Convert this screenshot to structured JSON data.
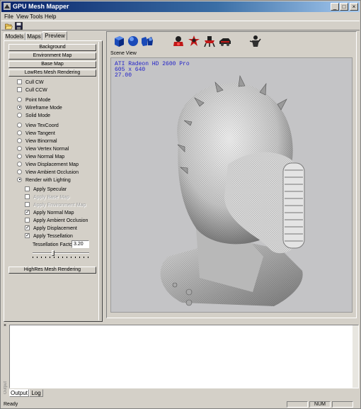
{
  "window": {
    "title": "GPU Mesh Mapper",
    "min": "_",
    "max": "□",
    "close": "×"
  },
  "menu": [
    "File",
    "View",
    "Tools",
    "Help"
  ],
  "left": {
    "tabs": [
      "Models",
      "Maps",
      "Preview"
    ],
    "active_tab": "Preview",
    "buttons": [
      "Background",
      "Environment Map",
      "Base Map",
      "LowRes Mesh Rendering"
    ],
    "cull": [
      {
        "label": "Cull CW",
        "checked": false
      },
      {
        "label": "Cull CCW",
        "checked": false
      }
    ],
    "modes": [
      {
        "label": "Point Mode",
        "selected": false
      },
      {
        "label": "Wireframe Mode",
        "selected": true
      },
      {
        "label": "Solid Mode",
        "selected": false
      }
    ],
    "views": [
      {
        "label": "View TexCoord",
        "selected": false
      },
      {
        "label": "View Tangent",
        "selected": false
      },
      {
        "label": "View Binormal",
        "selected": false
      },
      {
        "label": "View Vertex Normal",
        "selected": false
      },
      {
        "label": "View Normal Map",
        "selected": false
      },
      {
        "label": "View Displacement Map",
        "selected": false
      },
      {
        "label": "View Ambient Occlusion",
        "selected": false
      },
      {
        "label": "Render with Lighting",
        "selected": true
      }
    ],
    "apply": [
      {
        "label": "Apply Specular",
        "checked": false,
        "enabled": true
      },
      {
        "label": "Apply Base Map",
        "checked": false,
        "enabled": false
      },
      {
        "label": "Apply Environment Map",
        "checked": false,
        "enabled": false
      },
      {
        "label": "Apply Normal Map",
        "checked": true,
        "enabled": true
      },
      {
        "label": "Apply Ambient Occlusion",
        "checked": false,
        "enabled": true
      },
      {
        "label": "Apply Displacement",
        "checked": true,
        "enabled": true
      },
      {
        "label": "Apply Tessellation",
        "checked": true,
        "enabled": true
      }
    ],
    "tessellation_label": "Tessellation Factor",
    "tessellation_value": "3.20",
    "tessellation_slider": 0.35,
    "highres_button": "HighRes Mesh Rendering"
  },
  "scene": {
    "label": "Scene View",
    "overlay": [
      "ATI Radeon HD 2600 Pro",
      "605 x 640",
      "27.00"
    ]
  },
  "bottom": {
    "close": "×",
    "side_label": "Output",
    "tabs": [
      "Output",
      "Log"
    ],
    "active_tab": "Output"
  },
  "status": {
    "text": "Ready",
    "num": "NUM"
  },
  "colors": {
    "title_start": "#0a246a",
    "title_end": "#a6caf0",
    "overlay_text": "#2020c8",
    "viewport_bg": "#c4c4c6"
  }
}
